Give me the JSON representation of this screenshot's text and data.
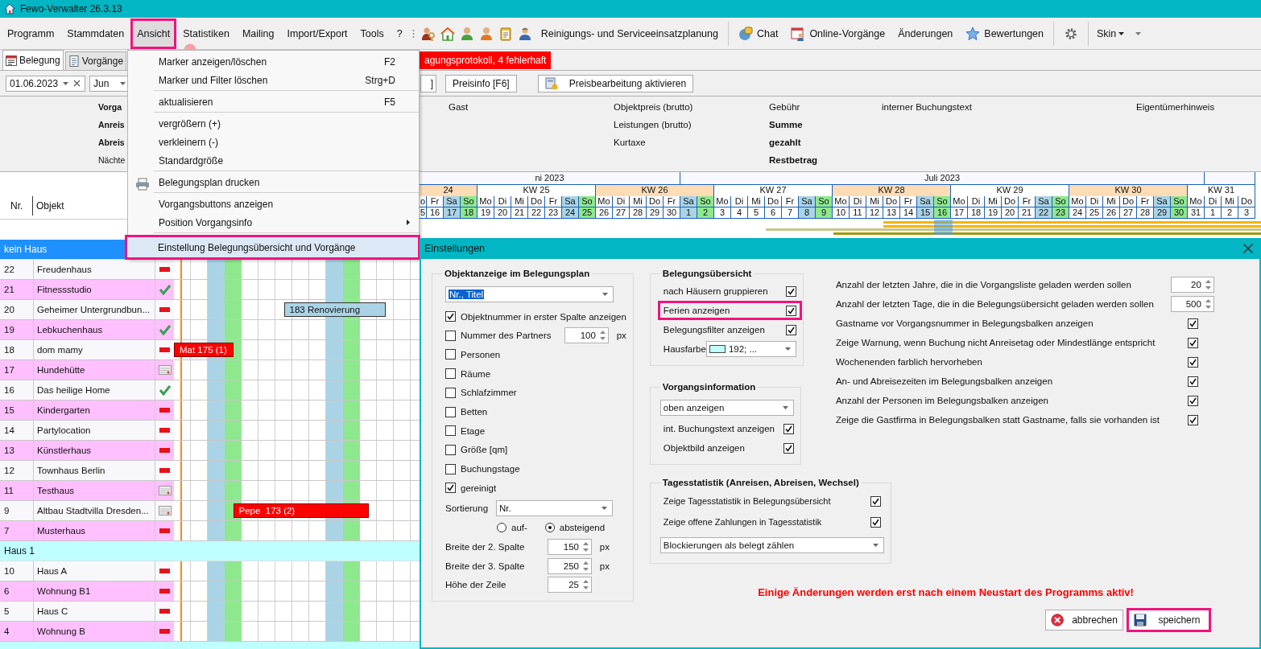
{
  "window": {
    "title": "Fewo-Verwalter 26.3.13"
  },
  "menu_bar": [
    {
      "label": "Programm",
      "selected": false,
      "highlighted": false
    },
    {
      "label": "Stammdaten",
      "selected": false,
      "highlighted": false
    },
    {
      "label": "Ansicht",
      "selected": true,
      "highlighted": true
    },
    {
      "label": "Statistiken",
      "selected": false,
      "highlighted": false
    },
    {
      "label": "Mailing",
      "selected": false,
      "highlighted": false
    },
    {
      "label": "Import/Export",
      "selected": false,
      "highlighted": false
    },
    {
      "label": "Tools",
      "selected": false,
      "highlighted": false
    },
    {
      "label": "?",
      "selected": false,
      "highlighted": false
    }
  ],
  "toolbar": {
    "planning": "Reinigungs- und Serviceeinsatzplanung",
    "chat": "Chat",
    "online": "Online-Vorgänge",
    "changes": "Änderungen",
    "ratings": "Bewertungen",
    "skin": "Skin"
  },
  "tabs": [
    {
      "label": "Belegung",
      "selected": true
    },
    {
      "label": "Vorgänge",
      "selected": false
    }
  ],
  "alert_banner": "agungsprotokoll, 4 fehlerhaft",
  "filters": {
    "date": "01.06.2023",
    "month": "Jun"
  },
  "buttons": [
    "]",
    "Preisinfo [F6]",
    "Preisbearbeitung aktivieren"
  ],
  "info_panel": {
    "columns": [
      [
        {
          "text": "Vorga",
          "bold": true
        },
        {
          "text": "Anreis",
          "bold": true
        },
        {
          "text": "Abreis",
          "bold": true
        },
        {
          "text": "Nächte",
          "bold": false
        }
      ],
      [
        {
          "text": "Gast",
          "bold": false
        }
      ],
      [
        {
          "text": "Objektpreis (brutto)",
          "bold": false
        },
        {
          "text": "Leistungen (brutto)",
          "bold": false
        },
        {
          "text": "Kurtaxe",
          "bold": false
        }
      ],
      [
        {
          "text": "Gebühr",
          "bold": false
        },
        {
          "text": "Summe",
          "bold": true
        },
        {
          "text": "gezahlt",
          "bold": true
        },
        {
          "text": "Restbetrag",
          "bold": true
        }
      ],
      [
        {
          "text": "interner Buchungstext",
          "bold": false
        }
      ],
      [
        {
          "text": "Eigentümerhinweis",
          "bold": false
        }
      ]
    ]
  },
  "object_header": {
    "number": "Nr.",
    "name": "Objekt"
  },
  "calendar": {
    "months": [
      {
        "label": "ni 2023"
      },
      {
        "label": "Juli 2023"
      }
    ],
    "weeks": [
      {
        "label": "24",
        "shaded": true,
        "days": [
          {
            "name": "o",
            "number": "5",
            "kind": "weekday",
            "partial": true
          },
          {
            "name": "Fr",
            "number": "16",
            "kind": "weekday"
          },
          {
            "name": "Sa",
            "number": "17",
            "kind": "saturday"
          },
          {
            "name": "So",
            "number": "18",
            "kind": "sunday"
          }
        ]
      },
      {
        "label": "KW 25",
        "shaded": false,
        "days": [
          {
            "name": "Mo",
            "number": "19",
            "kind": "weekday"
          },
          {
            "name": "Di",
            "number": "20",
            "kind": "weekday"
          },
          {
            "name": "Mi",
            "number": "21",
            "kind": "weekday"
          },
          {
            "name": "Do",
            "number": "22",
            "kind": "weekday"
          },
          {
            "name": "Fr",
            "number": "23",
            "kind": "weekday"
          },
          {
            "name": "Sa",
            "number": "24",
            "kind": "saturday"
          },
          {
            "name": "So",
            "number": "25",
            "kind": "sunday"
          }
        ]
      },
      {
        "label": "KW 26",
        "shaded": true,
        "days": [
          {
            "name": "Mo",
            "number": "26",
            "kind": "weekday"
          },
          {
            "name": "Di",
            "number": "27",
            "kind": "weekday"
          },
          {
            "name": "Mi",
            "number": "28",
            "kind": "weekday"
          },
          {
            "name": "Do",
            "number": "29",
            "kind": "weekday"
          },
          {
            "name": "Fr",
            "number": "30",
            "kind": "weekday"
          },
          {
            "name": "Sa",
            "number": "1",
            "kind": "saturday",
            "month_start": true
          },
          {
            "name": "So",
            "number": "2",
            "kind": "sunday"
          }
        ]
      },
      {
        "label": "KW 27",
        "shaded": false,
        "days": [
          {
            "name": "Mo",
            "number": "3",
            "kind": "weekday"
          },
          {
            "name": "Di",
            "number": "4",
            "kind": "weekday"
          },
          {
            "name": "Mi",
            "number": "5",
            "kind": "weekday"
          },
          {
            "name": "Do",
            "number": "6",
            "kind": "weekday"
          },
          {
            "name": "Fr",
            "number": "7",
            "kind": "weekday"
          },
          {
            "name": "Sa",
            "number": "8",
            "kind": "saturday"
          },
          {
            "name": "So",
            "number": "9",
            "kind": "sunday"
          }
        ]
      },
      {
        "label": "KW 28",
        "shaded": true,
        "days": [
          {
            "name": "Mo",
            "number": "10",
            "kind": "weekday"
          },
          {
            "name": "Di",
            "number": "11",
            "kind": "weekday"
          },
          {
            "name": "Mi",
            "number": "12",
            "kind": "weekday"
          },
          {
            "name": "Do",
            "number": "13",
            "kind": "weekday"
          },
          {
            "name": "Fr",
            "number": "14",
            "kind": "weekday"
          },
          {
            "name": "Sa",
            "number": "15",
            "kind": "saturday"
          },
          {
            "name": "So",
            "number": "16",
            "kind": "sunday"
          }
        ]
      },
      {
        "label": "KW 29",
        "shaded": false,
        "days": [
          {
            "name": "Mo",
            "number": "17",
            "kind": "weekday"
          },
          {
            "name": "Di",
            "number": "18",
            "kind": "weekday"
          },
          {
            "name": "Mi",
            "number": "19",
            "kind": "weekday"
          },
          {
            "name": "Do",
            "number": "20",
            "kind": "weekday"
          },
          {
            "name": "Fr",
            "number": "21",
            "kind": "weekday"
          },
          {
            "name": "Sa",
            "number": "22",
            "kind": "saturday"
          },
          {
            "name": "So",
            "number": "23",
            "kind": "sunday"
          }
        ]
      },
      {
        "label": "KW 30",
        "shaded": true,
        "days": [
          {
            "name": "Mo",
            "number": "24",
            "kind": "weekday"
          },
          {
            "name": "Di",
            "number": "25",
            "kind": "weekday"
          },
          {
            "name": "Mi",
            "number": "26",
            "kind": "weekday"
          },
          {
            "name": "Do",
            "number": "27",
            "kind": "weekday"
          },
          {
            "name": "Fr",
            "number": "28",
            "kind": "weekday"
          },
          {
            "name": "Sa",
            "number": "29",
            "kind": "saturday"
          },
          {
            "name": "So",
            "number": "30",
            "kind": "sunday"
          }
        ]
      },
      {
        "label": "KW 31",
        "shaded": false,
        "days": [
          {
            "name": "Mo",
            "number": "31",
            "kind": "weekday"
          },
          {
            "name": "Di",
            "number": "1",
            "kind": "weekday",
            "month_start": true
          },
          {
            "name": "Mi",
            "number": "2",
            "kind": "weekday"
          },
          {
            "name": "Do",
            "number": "3",
            "kind": "weekday"
          }
        ]
      }
    ]
  },
  "groups": [
    {
      "label": "kein Haus",
      "color": "#1e90ff",
      "rows": [
        {
          "number": "22",
          "name": "Freudenhaus",
          "kind": "minus"
        },
        {
          "number": "21",
          "name": "Fitnessstudio",
          "kind": "check"
        },
        {
          "number": "20",
          "name": "Geheimer Untergrundbun...",
          "kind": "minus",
          "bookings": [
            {
              "label": "183 Renovierung",
              "kind": "block"
            }
          ]
        },
        {
          "number": "19",
          "name": "Lebkuchenhaus",
          "kind": "check"
        },
        {
          "number": "18",
          "name": "dom mamy",
          "kind": "minus",
          "bookings": [
            {
              "label": "Mat 175 (1)",
              "kind": "booking"
            }
          ]
        },
        {
          "number": "17",
          "name": "Hundehütte",
          "kind": "calendar"
        },
        {
          "number": "16",
          "name": "Das heilige Home",
          "kind": "check"
        },
        {
          "number": "15",
          "name": "Kindergarten",
          "kind": "minus"
        },
        {
          "number": "14",
          "name": "Partylocation",
          "kind": "minus"
        },
        {
          "number": "13",
          "name": "Künstlerhaus",
          "kind": "minus"
        },
        {
          "number": "12",
          "name": "Townhaus Berlin",
          "kind": "minus"
        },
        {
          "number": "11",
          "name": "Testhaus",
          "kind": "calendar"
        },
        {
          "number": "9",
          "name": "Altbau Stadtvilla Dresden...",
          "kind": "calendar",
          "bookings": [
            {
              "label": "Pepe  173 (2)",
              "kind": "booking"
            }
          ]
        },
        {
          "number": "7",
          "name": "Musterhaus",
          "kind": "minus"
        }
      ]
    },
    {
      "label": "Haus 1",
      "color": "#c0ffff",
      "rows": [
        {
          "number": "10",
          "name": "Haus A",
          "kind": "minus"
        },
        {
          "number": "6",
          "name": "Wohnung B1",
          "kind": "minus"
        },
        {
          "number": "5",
          "name": "Haus C",
          "kind": "minus"
        },
        {
          "number": "4",
          "name": "Wohnung B",
          "kind": "minus"
        }
      ]
    },
    {
      "color": "#c0ffff"
    }
  ],
  "view_menu": {
    "sections": [
      [
        {
          "label": "Marker anzeigen/löschen",
          "shortcut": "F2",
          "kind": "plain",
          "selected": false,
          "highlighted": false
        },
        {
          "label": "Marker und Filter löschen",
          "shortcut": "Strg+D",
          "kind": "plain",
          "selected": false,
          "highlighted": false
        }
      ],
      [
        {
          "label": "aktualisieren",
          "shortcut": "F5",
          "kind": "plain",
          "selected": false,
          "highlighted": false
        }
      ],
      [
        {
          "label": "vergrößern (+)",
          "kind": "plain",
          "selected": false,
          "highlighted": false
        },
        {
          "label": "verkleinern (-)",
          "kind": "plain",
          "selected": false,
          "highlighted": false
        },
        {
          "label": "Standardgröße",
          "kind": "plain",
          "selected": false,
          "highlighted": false
        }
      ],
      [
        {
          "label": "Belegungsplan drucken",
          "kind": "print",
          "selected": false,
          "highlighted": false
        }
      ],
      [
        {
          "label": "Vorgangsbuttons anzeigen",
          "kind": "plain",
          "selected": false,
          "highlighted": false
        },
        {
          "label": "Position Vorgangsinfo",
          "kind": "submenu",
          "selected": false,
          "highlighted": false
        }
      ],
      [
        {
          "label": "Einstellung Belegungsübersicht und Vorgänge",
          "kind": "plain",
          "selected": true,
          "highlighted": true
        }
      ]
    ]
  },
  "settings_dialog": {
    "title": "Einstellungen",
    "object_display": {
      "title": "Objektanzeige im Belegungsplan",
      "display_mode": "Nr., Titel",
      "options": [
        {
          "label": "Objektnummer in erster Spalte anzeigen",
          "checked": true
        },
        {
          "label": "Nummer des Partners",
          "checked": false,
          "value": "100",
          "unit": "px"
        },
        {
          "label": "Personen",
          "checked": false
        },
        {
          "label": "Räume",
          "checked": false
        },
        {
          "label": "Schlafzimmer",
          "checked": false
        },
        {
          "label": "Betten",
          "checked": false
        },
        {
          "label": "Etage",
          "checked": false
        },
        {
          "label": "Größe [qm]",
          "checked": false
        },
        {
          "label": "Buchungstage",
          "checked": false
        },
        {
          "label": "gereinigt",
          "checked": true
        }
      ],
      "sort_label": "Sortierung",
      "sort_value": "Nr.",
      "sort_order": [
        {
          "label": "auf-",
          "selected": false
        },
        {
          "label": "absteigend",
          "selected": true
        }
      ],
      "sizes": [
        {
          "label": "Breite der 2. Spalte",
          "value": "150",
          "unit": "px"
        },
        {
          "label": "Breite der 3. Spalte",
          "value": "250",
          "unit": "px"
        },
        {
          "label": "Höhe der Zeile",
          "value": "25"
        }
      ]
    },
    "overview": {
      "title": "Belegungsübersicht",
      "options": [
        {
          "label": "nach Häusern gruppieren",
          "checked": true,
          "highlighted": false
        },
        {
          "label": "Ferien anzeigen",
          "checked": true,
          "highlighted": true
        },
        {
          "label": "Belegungsfilter anzeigen",
          "checked": true,
          "highlighted": false
        }
      ],
      "house_color": {
        "label": "Hausfarbe",
        "color": "#c0ffff",
        "value": "192; ..."
      }
    },
    "process_info": {
      "title": "Vorgangsinformation",
      "position": "oben anzeigen",
      "options": [
        {
          "label": "int. Buchungstext anzeigen",
          "checked": true
        },
        {
          "label": "Objektbild anzeigen",
          "checked": true
        }
      ]
    },
    "daily_stats": {
      "title": "Tagesstatistik (Anreisen, Abreisen, Wechsel)",
      "options": [
        {
          "label": "Zeige Tagesstatistik in Belegungsübersicht",
          "checked": true
        },
        {
          "label": "Zeige offene Zahlungen in Tagesstatistik",
          "checked": true
        }
      ],
      "blocking": "Blockierungen als belegt zählen"
    },
    "general": {
      "spins": [
        {
          "label": "Anzahl der letzten Jahre, die in die Vorgangsliste geladen werden sollen",
          "value": "20"
        },
        {
          "label": "Anzahl der letzten Tage, die in die Belegungsübersicht geladen werden sollen",
          "value": "500"
        }
      ],
      "options": [
        {
          "label": "Gastname vor Vorgangsnummer in Belegungsbalken anzeigen",
          "checked": true
        },
        {
          "label": "Zeige Warnung, wenn Buchung nicht Anreisetag oder Mindestlänge entspricht",
          "checked": true
        },
        {
          "label": "Wochenenden farblich hervorheben",
          "checked": true
        },
        {
          "label": "An- und Abreisezeiten im Belegungsbalken anzeigen",
          "checked": true
        },
        {
          "label": "Anzahl der Personen im Belegungsbalken anzeigen",
          "checked": true
        },
        {
          "label": "Zeige die Gastfirma in Belegungsbalken statt Gastname, falls sie vorhanden ist",
          "checked": true
        }
      ]
    },
    "warning": "Einige Änderungen werden erst nach einem Neustart des Programms aktiv!",
    "buttons": [
      {
        "label": "abbrechen",
        "kind": "cancel",
        "highlighted": false
      },
      {
        "label": "speichern",
        "kind": "save",
        "highlighted": true
      }
    ]
  }
}
